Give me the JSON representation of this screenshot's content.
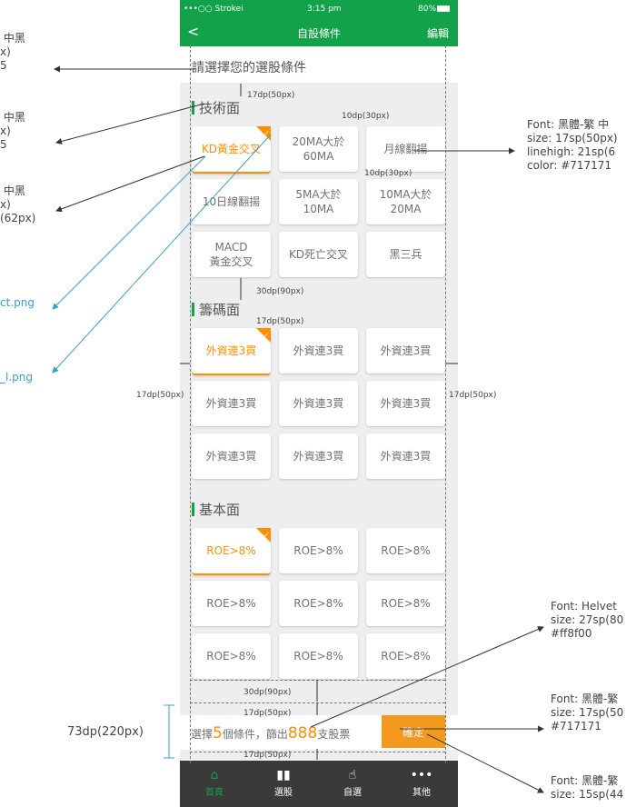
{
  "status": {
    "carrier": "•••○○ Strokei",
    "time": "3:15 pm",
    "battery": "80%"
  },
  "nav": {
    "back": "<",
    "title": "自設條件",
    "edit": "編輯"
  },
  "prompt": "請選擇您的選股條件",
  "sections": {
    "tech": "技術面",
    "chip": "籌碼面",
    "fund": "基本面"
  },
  "tech_options": [
    {
      "label": "KD黃金交叉",
      "selected": true
    },
    {
      "label": "20MA大於\n60MA",
      "selected": false
    },
    {
      "label": "月線翻揚",
      "selected": false
    },
    {
      "label": "10日線翻揚",
      "selected": false
    },
    {
      "label": "5MA大於\n10MA",
      "selected": false
    },
    {
      "label": "10MA大於\n20MA",
      "selected": false
    },
    {
      "label": "MACD\n黃金交叉",
      "selected": false
    },
    {
      "label": "KD死亡交叉",
      "selected": false
    },
    {
      "label": "黑三兵",
      "selected": false
    }
  ],
  "chip_options": [
    {
      "label": "外資連3買",
      "selected": true
    },
    {
      "label": "外資連3買",
      "selected": false
    },
    {
      "label": "外資連3買",
      "selected": false
    },
    {
      "label": "外資連3買",
      "selected": false
    },
    {
      "label": "外資連3買",
      "selected": false
    },
    {
      "label": "外資連3買",
      "selected": false
    },
    {
      "label": "外資連3買",
      "selected": false
    },
    {
      "label": "外資連3買",
      "selected": false
    },
    {
      "label": "外資連3買",
      "selected": false
    }
  ],
  "fund_options": [
    {
      "label": "ROE>8%",
      "selected": true
    },
    {
      "label": "ROE>8%",
      "selected": false
    },
    {
      "label": "ROE>8%",
      "selected": false
    },
    {
      "label": "ROE>8%",
      "selected": false
    },
    {
      "label": "ROE>8%",
      "selected": false
    },
    {
      "label": "ROE>8%",
      "selected": false
    },
    {
      "label": "ROE>8%",
      "selected": false
    },
    {
      "label": "ROE>8%",
      "selected": false
    },
    {
      "label": "ROE>8%",
      "selected": false
    }
  ],
  "summary": {
    "pre": "選擇",
    "count": "5",
    "mid": "個條件，篩出",
    "stocks": "888",
    "post": "支股票",
    "confirm": "確定"
  },
  "tabs": [
    {
      "label": "首頁",
      "icon": "⌂",
      "active": true
    },
    {
      "label": "選股",
      "icon": "▮▮",
      "active": false
    },
    {
      "label": "自選",
      "icon": "☝",
      "active": false
    },
    {
      "label": "其他",
      "icon": "•••",
      "active": false
    }
  ],
  "annotations": {
    "a1": "17dp(50px)",
    "a2": "10dp(30px)",
    "a3": "10dp(30px)",
    "a4": "30dp(90px)",
    "a5": "17dp(50px)",
    "a6": "17dp(50px)",
    "a7": "17dp(50px)",
    "a8": "30dp(90px)",
    "a9": "17dp(50px)",
    "a10": "17dp(50px)",
    "a11": "73dp(220px)"
  },
  "left_notes": {
    "n1": " 中黑\nx)\n5",
    "n2": " 中黑\nx)\n5",
    "n3": " 中黑\nx)\n(62px)",
    "n4": "ct.png",
    "n5": "_l.png"
  },
  "right_notes": {
    "r1": "Font: 黑體-繁 中\nsize: 17sp(50px)\nlinehigh: 21sp(6\ncolor: #717171",
    "r2": "Font: Helvet\nsize: 27sp(80\n#ff8f00",
    "r3": "Font: 黑體-繁\nsize: 17sp(50\n#717171",
    "r4": "Font: 黑體-繁\nsize: 15sp(44"
  }
}
